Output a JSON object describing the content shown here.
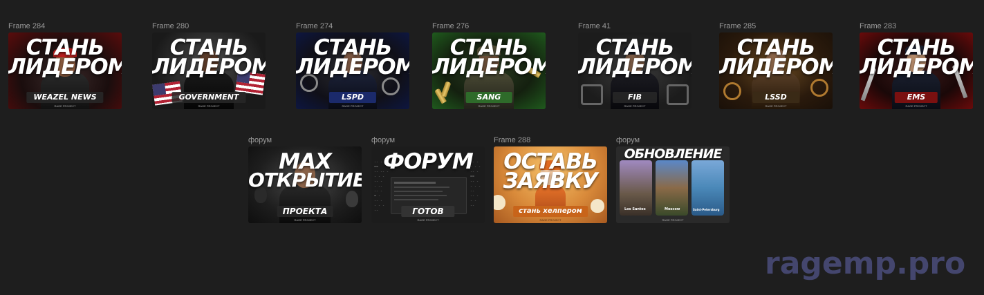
{
  "canvas": {
    "background": "#1e1e1e"
  },
  "row1": [
    {
      "label": "Frame 284",
      "line1": "СТАНЬ",
      "line2": "ЛИДЕРОМ",
      "faction": "WEAZEL NEWS",
      "accent": "#8a1212",
      "icon": "reporter-figure"
    },
    {
      "label": "Frame 280",
      "line1": "СТАНЬ",
      "line2": "ЛИДЕРОМ",
      "faction": "GOVERNMENT",
      "accent": "#3a3a3a",
      "icon": "suit-figure"
    },
    {
      "label": "Frame 274",
      "line1": "СТАНЬ",
      "line2": "ЛИДЕРОМ",
      "faction": "LSPD",
      "accent": "#1b2a6b",
      "icon": "police-figure"
    },
    {
      "label": "Frame 276",
      "line1": "СТАНЬ",
      "line2": "ЛИДЕРОМ",
      "faction": "SANG",
      "accent": "#2e6b2a",
      "icon": "soldier-figure"
    },
    {
      "label": "Frame 41",
      "line1": "СТАНЬ",
      "line2": "ЛИДЕРОМ",
      "faction": "FIB",
      "accent": "#454545",
      "icon": "fib-agent-figure"
    },
    {
      "label": "Frame 285",
      "line1": "СТАНЬ",
      "line2": "ЛИДЕРОМ",
      "faction": "LSSD",
      "accent": "#7a4a12",
      "icon": "sheriff-figure"
    },
    {
      "label": "Frame 283",
      "line1": "СТАНЬ",
      "line2": "ЛИДЕРОМ",
      "faction": "EMS",
      "accent": "#7a1010",
      "icon": "medic-figure"
    }
  ],
  "row2": [
    {
      "label": "форум",
      "line1": "МАХ",
      "line2": "ОТКРЫТИЕ",
      "plate": "ПРОЕКТА",
      "accent": "#3a3a3a",
      "icon": "man-portrait"
    },
    {
      "label": "форум",
      "line1": "ФОРУМ",
      "line2": "",
      "plate": "ГОТОВ",
      "accent": "#2a2a2a",
      "icon": "forum-screenshot"
    },
    {
      "label": "Frame 288",
      "line1": "ОСТАВЬ",
      "line2": "ЗАЯВКУ",
      "plate": "стань хелпером",
      "accent": "#d98a3a",
      "icon": "cartoon-boy"
    },
    {
      "label": "форум",
      "line1": "ОБНОВЛЕНИЕ",
      "line2": "",
      "cities": [
        "Los Santos",
        "Moscow",
        "Saint-Petersburg"
      ],
      "accent": "#333333",
      "icon": "city-cards"
    }
  ],
  "watermark": "ragemp.pro",
  "footer_micro": "RAGE PROJECT"
}
